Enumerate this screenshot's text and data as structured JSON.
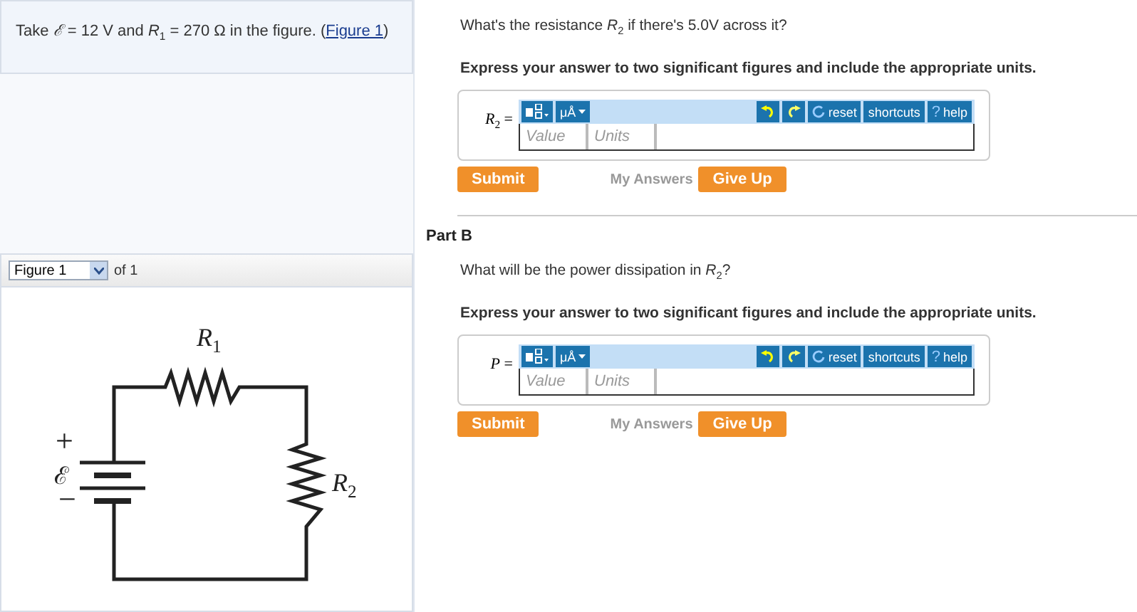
{
  "problem": {
    "text": "Take *ℰ* = 12 V and *R*$_{1}$ = 270 Ω in the figure. (",
    "link": "Figure 1",
    "text_after": ")"
  },
  "figure": {
    "select": "Figure 1",
    "of": "of 1",
    "labels": [
      {
        "kind": "r1",
        "text": "*R*$_{1}$"
      },
      {
        "kind": "r2",
        "text": "*R*$_{2}$"
      },
      {
        "kind": "plus",
        "text": "+"
      },
      {
        "kind": "emf",
        "text": "ℰ"
      },
      {
        "kind": "minus",
        "text": "−"
      }
    ]
  },
  "parts": [
    {
      "question": "What's the resistance *R*$_{2}$ if there's 5.0V across it?",
      "instruction": "Express your answer to two significant figures and include the appropriate units.",
      "answer_label": "*R*$_{2}$ =",
      "value_placeholder": "Value",
      "units_placeholder": "Units",
      "units_button": "μÅ",
      "reset": "reset",
      "shortcuts": "shortcuts",
      "help_mark": "?",
      "help": "help",
      "submit": "Submit",
      "my_answers": "My Answers",
      "give_up": "Give Up"
    },
    {
      "heading": "Part B",
      "question": "What will be the power dissipation in *R*$_{2}$?",
      "instruction": "Express your answer to two significant figures and include the appropriate units.",
      "answer_label": "*P* =",
      "value_placeholder": "Value",
      "units_placeholder": "Units",
      "units_button": "μÅ",
      "reset": "reset",
      "shortcuts": "shortcuts",
      "help_mark": "?",
      "help": "help",
      "submit": "Submit",
      "my_answers": "My Answers",
      "give_up": "Give Up"
    }
  ]
}
